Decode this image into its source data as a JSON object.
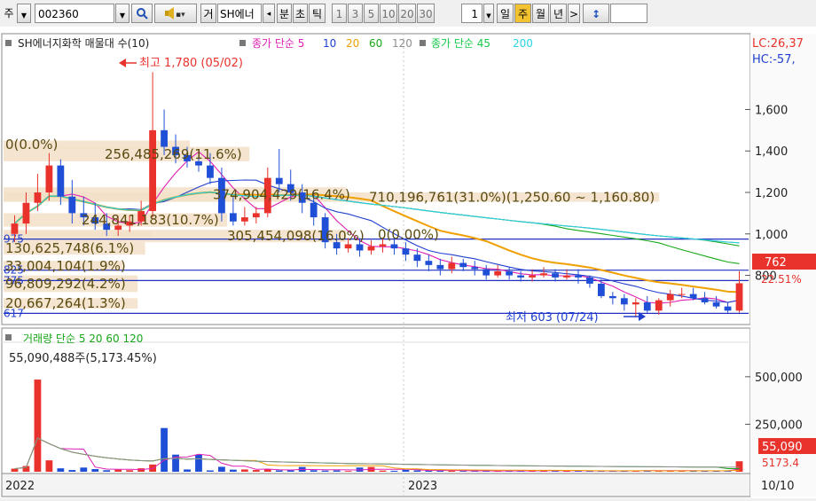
{
  "toolbar": {
    "market": "주",
    "code": "002360",
    "name": "SH에너",
    "name_btn": "거",
    "prev": "◂",
    "units": [
      "분",
      "초",
      "틱"
    ],
    "ticks": [
      "1",
      "3",
      "5",
      "10",
      "20",
      "30"
    ],
    "count": "1",
    "periods": [
      "일",
      "주",
      "월",
      "년"
    ],
    "next": ">",
    "updown": "↕",
    "selected_period": "주"
  },
  "colors": {
    "up": "#e8322b",
    "down": "#1f4fd6",
    "ma5": "#e020b4",
    "ma10": "#1f3fd0",
    "ma20": "#f0a000",
    "ma60": "#18a818",
    "ma120": "#8e8e8e",
    "ma200": "#2ad3e6",
    "hline": "#2030c0"
  },
  "chart_data": [
    {
      "type": "candlestick",
      "legend": {
        "title": "SH에너지화학 매물대 수(10)",
        "group1": "종가 단순 5",
        "group1_periods": [
          "10",
          "20",
          "60",
          "120"
        ],
        "group2": "종가 단순 45",
        "group2_periods": [
          "200"
        ]
      },
      "corner_labels": [
        "LC:26,37",
        "HC:-57,"
      ],
      "y_ticks": [
        1600,
        1400,
        1200,
        1000,
        800
      ],
      "y_tick_labels": [
        "1,600",
        "1,400",
        "1,200",
        "1,000",
        "800"
      ],
      "ylim": [
        580,
        1880
      ],
      "x_labels": [
        "2022",
        "2023"
      ],
      "last_price": "762",
      "last_change": "22.51%",
      "max_annotation": "최고 1,780 (05/02)",
      "min_annotation": "최저 603 (07/24)",
      "volume_profile": [
        {
          "label": "0(0.0%)",
          "low": 1410,
          "high": 1450,
          "frac": 0.25
        },
        {
          "label": "256,485,269(11.6%)",
          "low": 1350,
          "high": 1420,
          "frac": 0.33
        },
        {
          "label": "374,904,429(16.4%)",
          "low": 1155,
          "high": 1225,
          "frac": 0.46
        },
        {
          "label": "710,196,761(31.0%)(1,250.60 ~ 1,160.80)",
          "low": 1155,
          "high": 1200,
          "frac": 0.88
        },
        {
          "label": "244,841,183(10.7%)",
          "low": 1035,
          "high": 1100,
          "frac": 0.3
        },
        {
          "label": "305,454,098(16.0%)",
          "low": 960,
          "high": 1020,
          "frac": 0.46
        },
        {
          "label": "0(0.00%)",
          "low": 985,
          "high": 1010,
          "frac": 0.2
        },
        {
          "label": "130,625,748(6.1%)",
          "low": 900,
          "high": 960,
          "frac": 0.19
        },
        {
          "label": "33,004,104(1.9%)",
          "low": 820,
          "high": 870,
          "frac": 0.16
        },
        {
          "label": "96,809,292(4.2%)",
          "low": 720,
          "high": 800,
          "frac": 0.18
        },
        {
          "label": "20,667,264(1.3%)",
          "low": 640,
          "high": 690,
          "frac": 0.18
        }
      ],
      "price_lines": [
        {
          "value": 975,
          "label": "975"
        },
        {
          "value": 825,
          "label": "825"
        },
        {
          "value": 775,
          "label": "775"
        },
        {
          "value": 617,
          "label": "617"
        }
      ],
      "x": [
        "2022-01",
        "2022-01",
        "2022-01",
        "2022-02",
        "2022-02",
        "2022-02",
        "2022-03",
        "2022-03",
        "2022-03",
        "2022-04",
        "2022-04",
        "2022-04",
        "2022-05",
        "2022-05",
        "2022-05",
        "2022-06",
        "2022-06",
        "2022-06",
        "2022-07",
        "2022-07",
        "2022-07",
        "2022-08",
        "2022-08",
        "2022-08",
        "2022-09",
        "2022-09",
        "2022-09",
        "2022-10",
        "2022-10",
        "2022-10",
        "2022-11",
        "2022-11",
        "2022-11",
        "2022-12",
        "2022-12",
        "2022-12",
        "2023-01",
        "2023-01",
        "2023-01",
        "2023-02",
        "2023-02",
        "2023-02",
        "2023-03",
        "2023-03",
        "2023-03",
        "2023-04",
        "2023-04",
        "2023-04",
        "2023-05",
        "2023-05",
        "2023-05",
        "2023-06",
        "2023-06",
        "2023-06",
        "2023-07",
        "2023-07",
        "2023-07",
        "2023-08",
        "2023-08",
        "2023-08",
        "2023-09",
        "2023-09",
        "2023-09",
        "2023-10"
      ],
      "open": [
        1000,
        1050,
        1150,
        1200,
        1330,
        1180,
        1100,
        1080,
        1050,
        1020,
        1040,
        1060,
        1110,
        1500,
        1420,
        1380,
        1350,
        1330,
        1270,
        1100,
        1060,
        1080,
        1100,
        1270,
        1240,
        1200,
        1150,
        1080,
        960,
        930,
        950,
        920,
        940,
        950,
        930,
        900,
        870,
        850,
        830,
        860,
        840,
        830,
        800,
        820,
        800,
        790,
        800,
        810,
        790,
        800,
        790,
        760,
        700,
        690,
        660,
        670,
        630,
        680,
        710,
        710,
        690,
        670,
        650,
        630
      ],
      "close": [
        1050,
        1150,
        1200,
        1330,
        1180,
        1100,
        1080,
        1050,
        1020,
        1040,
        1060,
        1110,
        1500,
        1420,
        1380,
        1350,
        1330,
        1270,
        1100,
        1060,
        1080,
        1100,
        1270,
        1240,
        1200,
        1150,
        1080,
        960,
        930,
        950,
        920,
        940,
        950,
        930,
        900,
        870,
        850,
        830,
        860,
        840,
        830,
        800,
        820,
        800,
        790,
        800,
        810,
        790,
        800,
        790,
        760,
        700,
        690,
        660,
        670,
        630,
        680,
        710,
        710,
        690,
        670,
        650,
        630,
        762
      ],
      "high": [
        1090,
        1200,
        1290,
        1390,
        1360,
        1260,
        1180,
        1150,
        1100,
        1080,
        1090,
        1160,
        1780,
        1600,
        1480,
        1420,
        1390,
        1390,
        1320,
        1180,
        1130,
        1130,
        1320,
        1410,
        1310,
        1240,
        1200,
        1100,
        1000,
        980,
        980,
        970,
        980,
        980,
        960,
        930,
        900,
        880,
        890,
        880,
        870,
        850,
        850,
        840,
        820,
        830,
        840,
        830,
        830,
        830,
        800,
        780,
        720,
        710,
        690,
        700,
        690,
        730,
        740,
        740,
        720,
        700,
        670,
        820
      ],
      "low": [
        960,
        1000,
        1110,
        1160,
        1140,
        1050,
        1040,
        1020,
        990,
        990,
        1010,
        1040,
        1080,
        1380,
        1340,
        1320,
        1300,
        1240,
        1060,
        1040,
        1040,
        1050,
        1080,
        1200,
        1160,
        1100,
        1040,
        930,
        900,
        910,
        890,
        900,
        910,
        900,
        870,
        840,
        820,
        800,
        810,
        820,
        800,
        780,
        790,
        780,
        770,
        770,
        790,
        770,
        780,
        760,
        740,
        690,
        660,
        630,
        603,
        620,
        610,
        650,
        690,
        680,
        660,
        640,
        620,
        620
      ],
      "volume_panel": {
        "legend": "거래량 단순 5 20 60 120",
        "info": "55,090,488주(5,173.45%)",
        "y_ticks": [
          "500,000",
          "250,000"
        ],
        "y_tick_values": [
          500000,
          250000
        ],
        "ylim": [
          0,
          560000
        ],
        "last_volume": "55,090",
        "last_ratio": "5173.4",
        "bottom_right": "10/10",
        "values": [
          16000,
          30000,
          485000,
          60000,
          18000,
          9000,
          22000,
          14000,
          8000,
          11000,
          8000,
          18000,
          38000,
          230000,
          90000,
          12000,
          90000,
          7000,
          26000,
          11000,
          12000,
          9000,
          12000,
          7000,
          7000,
          25000,
          8000,
          6000,
          7000,
          4000,
          22000,
          25000,
          6000,
          5000,
          10000,
          7000,
          6000,
          5000,
          6000,
          4000,
          3000,
          5000,
          4000,
          5000,
          4000,
          5000,
          8000,
          4000,
          5000,
          4000,
          3000,
          4000,
          6000,
          5000,
          6000,
          7000,
          5000,
          4000,
          6000,
          5000,
          4000,
          5000,
          4000,
          55090
        ]
      }
    }
  ]
}
